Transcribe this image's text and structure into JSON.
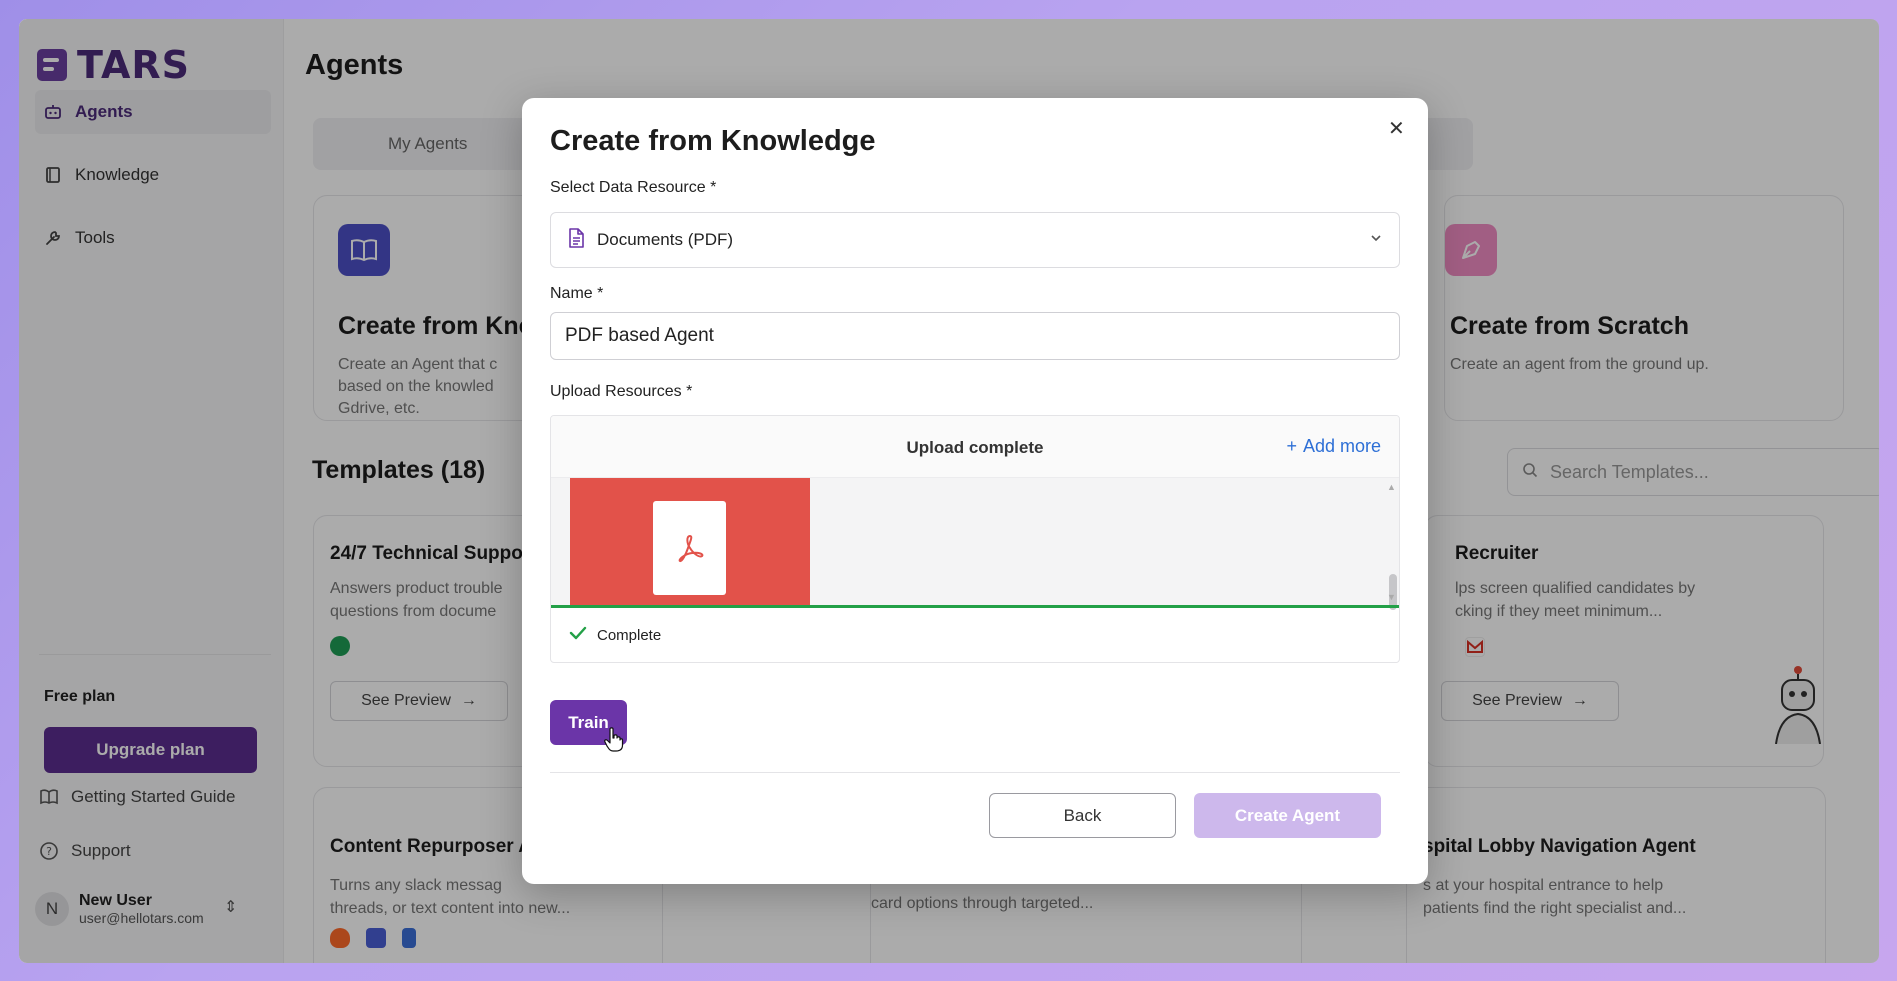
{
  "app": {
    "logo_text": "TARS"
  },
  "sidebar": {
    "items": [
      {
        "label": "Agents",
        "icon": "bot-icon",
        "active": true
      },
      {
        "label": "Knowledge",
        "icon": "book-icon"
      },
      {
        "label": "Tools",
        "icon": "wrench-icon"
      }
    ],
    "plan": {
      "title": "Free plan",
      "upgrade_label": "Upgrade plan"
    },
    "footer": [
      {
        "label": "Getting Started Guide",
        "icon": "open-book-icon"
      },
      {
        "label": "Support",
        "icon": "help-circle-icon"
      }
    ],
    "user": {
      "initial": "N",
      "name": "New User",
      "email": "user@hellotars.com"
    }
  },
  "main": {
    "title": "Agents",
    "tabs": [
      {
        "label": "My Agents"
      }
    ],
    "create_cards": [
      {
        "title": "Create from Kno",
        "desc": "Create an Agent that c\nbased on the knowled\nGdrive, etc."
      },
      {
        "title": "Create from Scratch",
        "desc": "Create an agent from the ground up."
      }
    ],
    "templates_title": "Templates (18)",
    "search_placeholder": "Search Templates...",
    "templates": [
      {
        "title": "24/7 Technical Suppo",
        "desc": "Answers product trouble\nquestions from docume",
        "preview": "See Preview"
      },
      {
        "title": "Recruiter",
        "desc": "lps screen qualified candidates by\ncking if they meet minimum...",
        "preview": "See Preview"
      },
      {
        "title": "Content Repurposer A",
        "desc": "Turns any slack messag\nthreads, or text content into new..."
      },
      {
        "title": "spital Lobby Navigation Agent",
        "desc": "s at your hospital entrance to help\npatients find the right specialist and..."
      },
      {
        "title": "",
        "desc": "card options through targeted..."
      }
    ]
  },
  "modal": {
    "title": "Create from Knowledge",
    "data_resource_label": "Select Data Resource *",
    "data_resource_value": "Documents (PDF)",
    "name_label": "Name *",
    "name_value": "PDF based Agent",
    "upload_label": "Upload Resources *",
    "upload_status": "Upload complete",
    "add_more_label": "Add more",
    "file_status": "Complete",
    "upload_progress": 1.0,
    "train_label": "Train",
    "back_label": "Back",
    "create_label": "Create Agent",
    "close_symbol": "✕"
  },
  "colors": {
    "brand": "#5b2e8f",
    "train": "#6b35a8",
    "create_disabled": "#cdb8ec",
    "progress": "#23a047",
    "link": "#2d6fd6",
    "pdf": "#e2524a"
  }
}
